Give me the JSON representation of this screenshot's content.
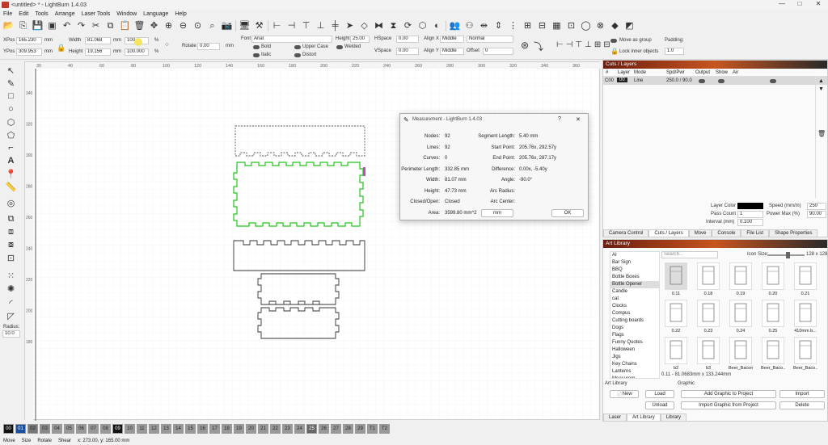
{
  "window": {
    "title": "<untitled> * - LightBurn 1.4.03",
    "min": "—",
    "max": "□",
    "close": "✕"
  },
  "menu": [
    "File",
    "Edit",
    "Tools",
    "Arrange",
    "Laser Tools",
    "Window",
    "Language",
    "Help"
  ],
  "props": {
    "xpos_label": "XPos",
    "xpos": "165.230",
    "ypos_label": "YPos",
    "ypos": "309.953",
    "unit": "mm",
    "width_label": "Width",
    "width": "81.068",
    "height_label": "Height",
    "height": "19.156",
    "scale_w": "100",
    "scale_h": "100.000",
    "pct": "%",
    "rotate_label": "Rotate",
    "rotate": "0.00",
    "rot_unit": "mm",
    "font_label": "Font",
    "font": "Arial",
    "theight_label": "Height",
    "theight": "25.00",
    "hspace_label": "HSpace",
    "hspace": "0.00",
    "vspace_label": "VSpace",
    "vspace": "0.00",
    "alignx_label": "Align X",
    "alignx": "Middle",
    "aligny_label": "Align Y",
    "aligny": "Middle",
    "normal": "Normal",
    "offset_label": "Offset",
    "offset": "0",
    "bold": "Bold",
    "upper": "Upper Case",
    "welded": "Welded",
    "italic": "Italic",
    "distort": "Distort",
    "move_group": "Move as group",
    "lock_inner": "Lock inner objects",
    "padding_label": "Padding:",
    "padding": "1.0"
  },
  "ruler_x": [
    "30",
    "40",
    "60",
    "80",
    "100",
    "120",
    "140",
    "160",
    "180",
    "200",
    "220",
    "240",
    "260",
    "280",
    "300",
    "320",
    "340",
    "360",
    "380",
    "400"
  ],
  "ruler_y": [
    "340",
    "320",
    "300",
    "280",
    "260",
    "240",
    "220",
    "200",
    "180"
  ],
  "left_radius_label": "Radius:",
  "left_radius": "10.0",
  "palette": [
    "00",
    "01",
    "02",
    "03",
    "04",
    "05",
    "06",
    "07",
    "08",
    "09",
    "10",
    "11",
    "12",
    "13",
    "14",
    "15",
    "16",
    "17",
    "18",
    "19",
    "20",
    "21",
    "22",
    "23",
    "24",
    "25",
    "26",
    "27",
    "28",
    "29",
    "T1",
    "T2"
  ],
  "palette_colors": [
    "#111",
    "#1a4fa0",
    "#777",
    "#888",
    "#999",
    "#999",
    "#999",
    "#999",
    "#999",
    "#111",
    "#999",
    "#999",
    "#999",
    "#999",
    "#999",
    "#999",
    "#999",
    "#999",
    "#999",
    "#999",
    "#999",
    "#999",
    "#999",
    "#999",
    "#999",
    "#666",
    "#999",
    "#999",
    "#999",
    "#999",
    "#999",
    "#999"
  ],
  "status": {
    "move": "Move",
    "size": "Size",
    "rotate": "Rotate",
    "shear": "Shear",
    "coords": "x: 273.00, y: 165.00 mm"
  },
  "cuts": {
    "title": "Cuts / Layers",
    "headers": [
      "#",
      "Layer",
      "Mode",
      "Spd/Pwr",
      "Output",
      "Show",
      "Air"
    ],
    "row": {
      "id": "C00",
      "layer": "00",
      "mode": "Line",
      "spdpwr": "250.0 / 90.0"
    },
    "layer_color_label": "Layer Color",
    "speed_label": "Speed (mm/m)",
    "speed": "250",
    "pass_label": "Pass Count",
    "pass": "1",
    "power_label": "Power Max (%)",
    "power": "90.00",
    "interval_label": "Interval (mm)",
    "interval": "0.100",
    "tabs": [
      "Camera Control",
      "Cuts / Layers",
      "Move",
      "Console",
      "File List",
      "Shape Properties"
    ]
  },
  "dialog": {
    "title": "Measurement - LightBurn 1.4.03",
    "help": "?",
    "close": "✕",
    "left": [
      [
        "Nodes:",
        "92"
      ],
      [
        "Lines:",
        "92"
      ],
      [
        "Curves:",
        "0"
      ],
      [
        "Perimeter Length:",
        "332.85 mm"
      ],
      [
        "Width:",
        "81.07 mm"
      ],
      [
        "Height:",
        "47.73 mm"
      ],
      [
        "Closed/Open:",
        "Closed"
      ]
    ],
    "right": [
      [
        "Segment Length:",
        "5.40 mm"
      ],
      [
        "Start Point:",
        "205.76x, 292.57y"
      ],
      [
        "End Point:",
        "205.76x, 287.17y"
      ],
      [
        "Difference:",
        "0.00x, -5.40y"
      ],
      [
        "Angle:",
        "-90.0°"
      ],
      [
        "Arc Radius:",
        ""
      ],
      [
        "Arc Center:",
        ""
      ]
    ],
    "area_label": "Area:",
    "area": "3599.80 mm^2",
    "unit_btn": "mm",
    "ok": "OK"
  },
  "art": {
    "title": "Art Library",
    "search": "Search...",
    "icon_size": "Icon Size:",
    "dims": "128 x 128",
    "cats": [
      "AI",
      "Bar Sign",
      "BBQ",
      "Bottle Boxes",
      "Bottle Opener",
      "Candle",
      "cat",
      "Clocks",
      "Compus",
      "Cutting boards",
      "Dogs",
      "Flags",
      "Funny Quotes",
      "Halloween",
      "Jigs",
      "Key Chains",
      "Lanterns",
      "Measurem..."
    ],
    "selected": "Bottle Opener",
    "thumbs": [
      "0.11",
      "0.18",
      "0.19",
      "0.20",
      "0.21",
      "0.22",
      "0.23",
      "0.24",
      "0.25",
      "410mm b...",
      "b2",
      "b3",
      "Beer_Bacon",
      "Beer_Baco...",
      "Beer_Baco..."
    ],
    "info": "0.11 - 81.0683mm x 133.244mm",
    "lib_label": "Art Library",
    "graphic_label": "Graphic",
    "new": "New",
    "load": "Load",
    "unload": "Unload",
    "add": "Add Graphic to Project",
    "import": "Import",
    "import_from": "Import Graphic from Project",
    "delete": "Delete",
    "tabs": [
      "Laser",
      "Art Library",
      "Library"
    ]
  }
}
